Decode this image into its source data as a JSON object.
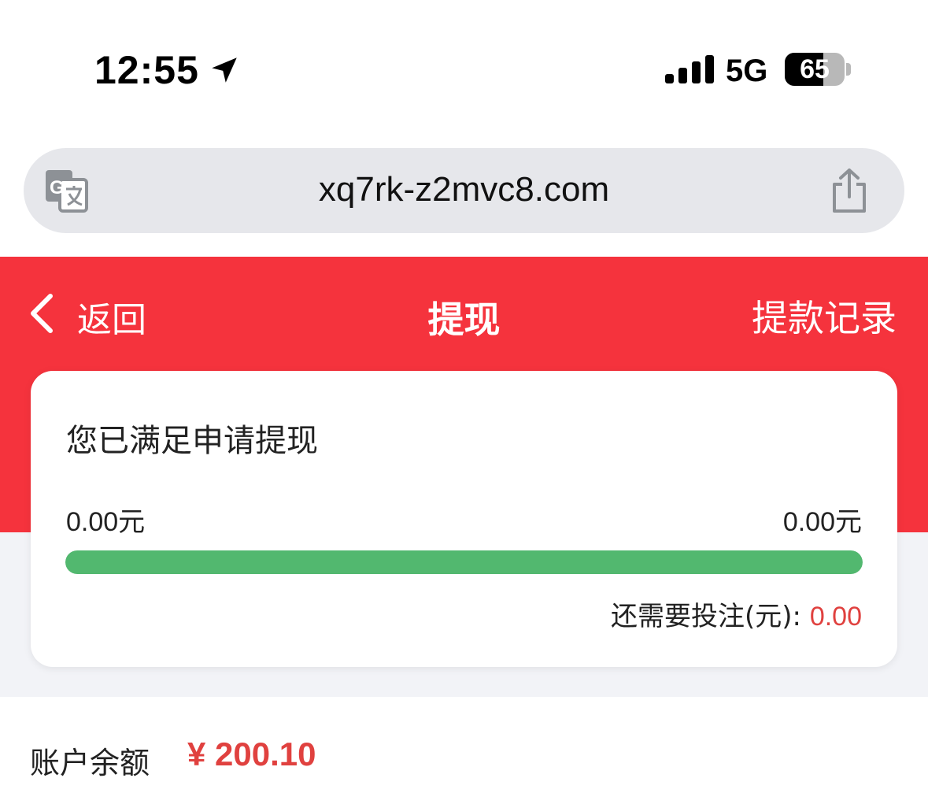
{
  "status_bar": {
    "time": "12:55",
    "network": "5G",
    "battery_percent": 65,
    "battery_label": "65",
    "icons": [
      "location-arrow-icon",
      "signal-icon"
    ]
  },
  "browser": {
    "url": "xq7rk-z2mvc8.com",
    "icons": [
      "translate-icon",
      "share-icon"
    ]
  },
  "nav": {
    "back_label": "返回",
    "title": "提现",
    "records_label": "提款记录",
    "background_color": "#f5333d"
  },
  "progress_card": {
    "title": "您已满足申请提现",
    "current_amount": "0.00元",
    "target_amount": "0.00元",
    "progress_fraction": 1.0,
    "progress_color": "#52b86f",
    "remaining_label": "还需要投注(元):",
    "remaining_value": "0.00"
  },
  "balance": {
    "label": "账户余额",
    "value": "¥ 200.10",
    "value_color": "#e0413f"
  }
}
